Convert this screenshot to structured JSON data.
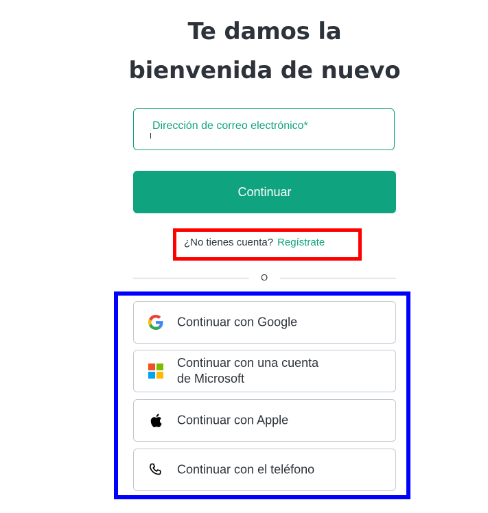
{
  "header": {
    "title_line1": "Te damos la",
    "title_line2": "bienvenida de nuevo"
  },
  "email": {
    "label": "Dirección de correo electrónico*",
    "value": ""
  },
  "continue_button": {
    "label": "Continuar"
  },
  "signup": {
    "prompt": "¿No tienes cuenta?",
    "link": "Regístrate"
  },
  "divider": {
    "text": "O"
  },
  "social": {
    "google": {
      "label": "Continuar con Google",
      "icon": "google-icon"
    },
    "microsoft": {
      "label_line1": "Continuar con una cuenta",
      "label_line2": "de Microsoft",
      "icon": "microsoft-icon"
    },
    "apple": {
      "label": "Continuar con Apple",
      "icon": "apple-icon"
    },
    "phone": {
      "label": "Continuar con el teléfono",
      "icon": "phone-icon"
    }
  },
  "colors": {
    "accent": "#10a37f",
    "text": "#2d333a",
    "border": "#c2c8d0",
    "highlight_red": "#ff0000",
    "highlight_blue": "#0000ff"
  }
}
